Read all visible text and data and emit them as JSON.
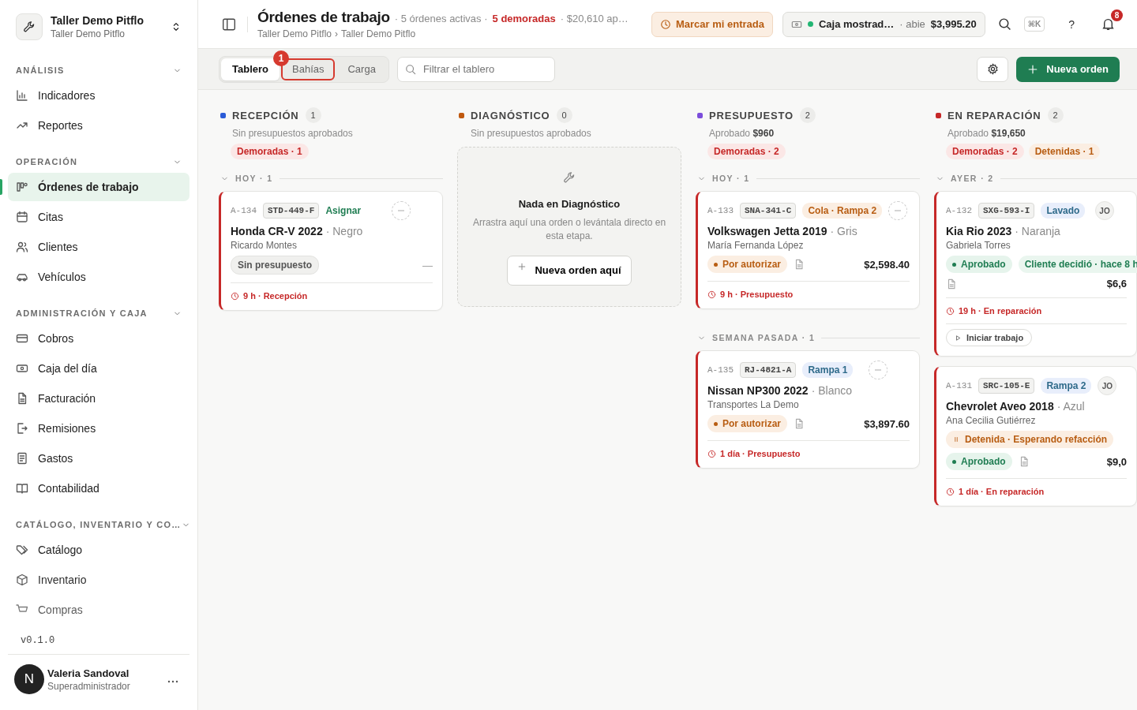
{
  "workspace": {
    "name": "Taller Demo Pitflo",
    "subtitle": "Taller Demo Pitflo"
  },
  "sidebar": {
    "sections": [
      {
        "title": "ANÁLISIS",
        "items": [
          {
            "label": "Indicadores",
            "selected": false
          },
          {
            "label": "Reportes",
            "selected": false
          }
        ]
      },
      {
        "title": "OPERACIÓN",
        "items": [
          {
            "label": "Órdenes de trabajo",
            "selected": true
          },
          {
            "label": "Citas",
            "selected": false
          },
          {
            "label": "Clientes",
            "selected": false
          },
          {
            "label": "Vehículos",
            "selected": false
          }
        ]
      },
      {
        "title": "ADMINISTRACIÓN Y CAJA",
        "items": [
          {
            "label": "Cobros",
            "selected": false
          },
          {
            "label": "Caja del día",
            "selected": false
          },
          {
            "label": "Facturación",
            "selected": false
          },
          {
            "label": "Remisiones",
            "selected": false
          },
          {
            "label": "Gastos",
            "selected": false
          },
          {
            "label": "Contabilidad",
            "selected": false
          }
        ]
      },
      {
        "title": "CATÁLOGO, INVENTARIO Y CO…",
        "items": [
          {
            "label": "Catálogo",
            "selected": false
          },
          {
            "label": "Inventario",
            "selected": false
          },
          {
            "label": "Compras",
            "selected": false
          }
        ]
      }
    ],
    "version": "v0.1.0",
    "user": {
      "initial": "N",
      "name": "Valeria Sandoval",
      "role": "Superadministrador"
    }
  },
  "header": {
    "title": "Órdenes de trabajo",
    "summary": [
      {
        "text": "· 5 órdenes activas ·",
        "kind": "plain"
      },
      {
        "text": "5 demoradas",
        "kind": "alert"
      },
      {
        "text": "· $20,610 ap…",
        "kind": "plain"
      }
    ],
    "breadcrumb": [
      "Taller Demo Pitflo",
      "Taller Demo Pitflo"
    ],
    "separator": "›",
    "clock_in": "Marcar mi entrada",
    "register": {
      "name": "Caja mostrad…",
      "open": true,
      "status": "· abie",
      "amount": "$3,995.20"
    },
    "shortcut": "⌘K",
    "help": "?",
    "notifications": "8"
  },
  "toolbar": {
    "tabs": [
      {
        "label": "Tablero",
        "selected": true
      },
      {
        "label": "Bahías",
        "selected": false,
        "marker": "1"
      },
      {
        "label": "Carga",
        "selected": false
      }
    ],
    "filter": {
      "placeholder": "Filtrar el tablero"
    },
    "new_order": "Nueva orden"
  },
  "columns": [
    {
      "name": "RECEPCIÓN",
      "color": "#2b5bd7",
      "count": "1",
      "subtitle": "Sin presupuestos aprobados",
      "chips": [
        {
          "text": "Demoradas · 1",
          "kind": "delayed"
        }
      ],
      "groups": [
        {
          "label": "HOY · 1",
          "cards": [
            {
              "id": "A-134",
              "plate": "STD-449-F",
              "tag": {
                "text": "Asignar",
                "kind": "action"
              },
              "vehicle": "Honda CR-V 2022",
              "color_name": "· Negro",
              "customer": "Ricardo Montes",
              "delayed": true,
              "chips": [
                {
                  "text": "Sin presupuesto",
                  "kind": "neutral"
                }
              ],
              "doc": false,
              "amount": "—",
              "footer": "9 h · Recepción"
            }
          ]
        }
      ]
    },
    {
      "name": "DIAGNÓSTICO",
      "color": "#c0590f",
      "count": "0",
      "subtitle": "Sin presupuestos aprobados",
      "empty": {
        "title": "Nada en Diagnóstico",
        "text": "Arrastra aquí una orden o levántala directo en esta etapa.",
        "button": "Nueva orden aquí"
      }
    },
    {
      "name": "PRESUPUESTO",
      "color": "#7c4ddb",
      "count": "2",
      "subtitle": "Aprobado **$960**",
      "chips": [
        {
          "text": "Demoradas · 2",
          "kind": "delayed"
        }
      ],
      "groups": [
        {
          "label": "HOY · 1",
          "cards": [
            {
              "id": "A-133",
              "plate": "SNA-341-C",
              "tag": {
                "text": "Cola · Rampa 2",
                "kind": "queue"
              },
              "vehicle": "Volkswagen Jetta 2019",
              "color_name": "· Gris",
              "customer": "María Fernanda López",
              "delayed": true,
              "chips": [
                {
                  "text": "Por autorizar",
                  "kind": "pending"
                }
              ],
              "doc": true,
              "amount": "$2,598.40",
              "footer": "9 h · Presupuesto"
            }
          ]
        },
        {
          "label": "SEMANA PASADA · 1",
          "cards": [
            {
              "id": "A-135",
              "plate": "RJ-4821-A",
              "tag": {
                "text": "Rampa 1",
                "kind": "bay"
              },
              "vehicle": "Nissan NP300 2022",
              "color_name": "· Blanco",
              "customer": "Transportes La Demo",
              "delayed": true,
              "chips": [
                {
                  "text": "Por autorizar",
                  "kind": "pending"
                }
              ],
              "doc": true,
              "amount": "$3,897.60",
              "footer": "1 día · Presupuesto"
            }
          ]
        }
      ]
    },
    {
      "name": "EN REPARACIÓN",
      "color": "#c62828",
      "count": "2",
      "subtitle": "Aprobado **$19,650**",
      "chips": [
        {
          "text": "Demoradas · 2",
          "kind": "delayed"
        },
        {
          "text": "Detenidas · 1",
          "kind": "stopped"
        }
      ],
      "groups": [
        {
          "label": "AYER · 2",
          "cards": [
            {
              "id": "A-132",
              "plate": "SXG-593-I",
              "tag": {
                "text": "Lavado",
                "kind": "bay"
              },
              "assignee": "JO",
              "vehicle": "Kia Rio 2023",
              "color_name": "· Naranja",
              "customer": "Gabriela Torres",
              "delayed": true,
              "chips": [
                {
                  "text": "Aprobado",
                  "kind": "approved"
                },
                {
                  "text": "Cliente decidió · hace 8 h",
                  "kind": "decision"
                }
              ],
              "doc": true,
              "amount": "$6,6",
              "footer": "19 h · En reparación",
              "action": "Iniciar trabajo"
            },
            {
              "id": "A-131",
              "plate": "SRC-105-E",
              "tag": {
                "text": "Rampa 2",
                "kind": "bay"
              },
              "assignee": "JO",
              "vehicle": "Chevrolet Aveo 2018",
              "color_name": "· Azul",
              "customer": "Ana Cecilia Gutiérrez",
              "delayed": true,
              "hold": "Detenida · Esperando refacción",
              "chips": [
                {
                  "text": "Aprobado",
                  "kind": "approved"
                }
              ],
              "doc": true,
              "amount": "$9,0",
              "footer": "1 día · En reparación"
            }
          ]
        }
      ]
    }
  ]
}
